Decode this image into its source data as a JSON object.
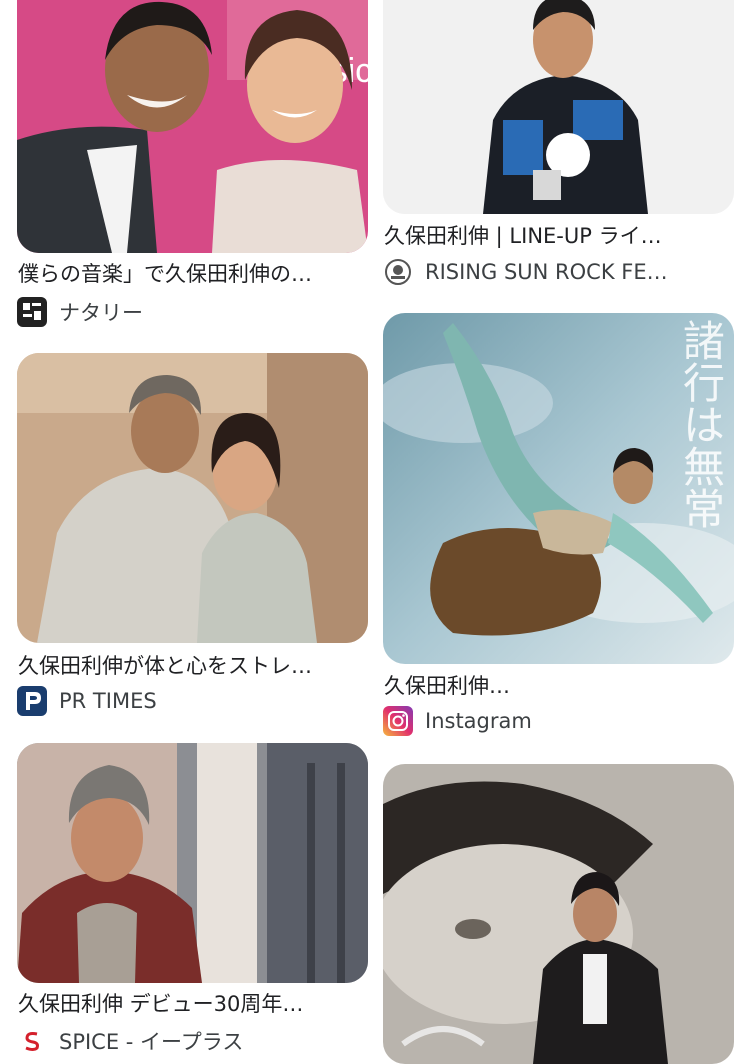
{
  "results": [
    {
      "caption": "僕らの音楽」で久保田利伸の…",
      "source": "ナタリー",
      "source_icon": "natalie-logo-icon"
    },
    {
      "caption": "久保田利伸 | LINE-UP ライ…",
      "source": "RISING SUN ROCK FE…",
      "source_icon": "rising-sun-logo-icon"
    },
    {
      "caption": "久保田利伸が体と心をストレ…",
      "source": "PR TIMES",
      "source_icon": "pr-times-logo-icon"
    },
    {
      "caption": "久保田利伸…",
      "source": "Instagram",
      "source_icon": "instagram-logo-icon"
    },
    {
      "caption": "久保田利伸 デビュー30周年…",
      "source": "SPICE - イープラス",
      "source_icon": "spice-logo-icon"
    }
  ],
  "image_text": {
    "vertical_title": "諸行は無常",
    "logo_fragment": "our sic"
  },
  "colors": {
    "pink_backdrop": "#d64a86",
    "pr_times_blue": "#1a3d6e",
    "spice_red": "#d4202c",
    "sky_blue": "#a9c7d2"
  }
}
